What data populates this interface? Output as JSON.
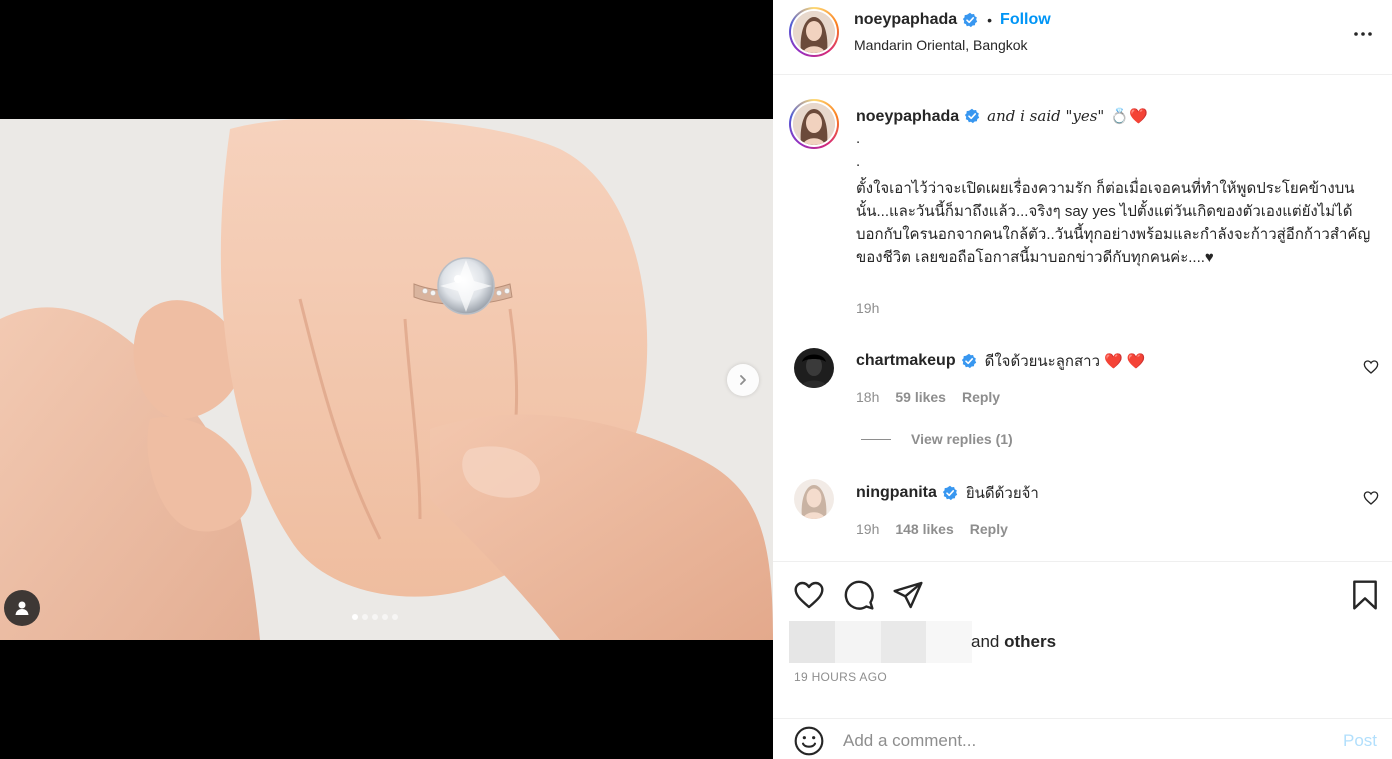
{
  "post": {
    "username": "noeypaphada",
    "location": "Mandarin Oriental, Bangkok",
    "follow_label": "Follow",
    "separator": "•",
    "carousel": {
      "total_slides": 5,
      "active_slide": 1
    }
  },
  "caption": {
    "username": "noeypaphada",
    "title": "and i said \"yes\"",
    "emoji": "💍❤️",
    "dot_lines": [
      ".",
      "."
    ],
    "body": "ตั้งใจเอาไว้ว่าจะเปิดเผยเรื่องความรัก ก็ต่อเมื่อเจอคนที่ทำให้พูดประโยคข้างบนนั้น...และวันนี้ก็มาถึงแล้ว...จริงๆ say yes ไปตั้งแต่วันเกิดของตัวเองแต่ยังไม่ได้บอกกับใครนอกจากคนใกล้ตัว..วันนี้ทุกอย่างพร้อมและกำลังจะก้าวสู่อีกก้าวสำคัญของชีวิต เลยขอถือโอกาสนี้มาบอกข่าวดีกับทุกคนค่ะ....♥",
    "time": "19h"
  },
  "comments": [
    {
      "username": "chartmakeup",
      "text": "ดีใจด้วยนะลูกสาว",
      "emoji": "❤️ ❤️",
      "time": "18h",
      "likes": "59 likes",
      "reply_label": "Reply",
      "view_replies": "View replies (1)"
    },
    {
      "username": "ningpanita",
      "text": "ยินดีด้วยจ้า",
      "time": "19h",
      "likes": "148 likes",
      "reply_label": "Reply"
    }
  ],
  "likes": {
    "and_label": "and",
    "others_label": "others"
  },
  "posted_ago": "19 HOURS AGO",
  "comment_box": {
    "placeholder": "Add a comment...",
    "post_label": "Post"
  },
  "colors": {
    "accent": "#0095f6",
    "post_disabled": "#b2dffc",
    "muted": "#8e8e8e",
    "verified": "#3897f0",
    "heart_red": "#ed4956"
  },
  "icons": {
    "more": "more-horizontal-icon",
    "like": "heart-outline-icon",
    "comment": "comment-bubble-icon",
    "share": "paper-plane-icon",
    "save": "bookmark-icon",
    "emoji": "smiley-icon",
    "next": "chevron-right-icon",
    "tag": "user-tag-icon"
  }
}
